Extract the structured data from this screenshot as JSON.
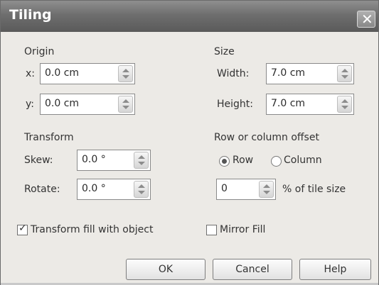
{
  "dialog": {
    "title": "Tiling",
    "close_icon": "close-icon"
  },
  "origin": {
    "heading": "Origin",
    "x_label": "x:",
    "x_value": "0.0 cm",
    "y_label": "y:",
    "y_value": "0.0 cm"
  },
  "size": {
    "heading": "Size",
    "width_label": "Width:",
    "width_value": "7.0 cm",
    "height_label": "Height:",
    "height_value": "7.0 cm"
  },
  "transform": {
    "heading": "Transform",
    "skew_label": "Skew:",
    "skew_value": "0.0 °",
    "rotate_label": "Rotate:",
    "rotate_value": "0.0 °"
  },
  "offset": {
    "heading": "Row or column offset",
    "row_label": "Row",
    "row_selected": true,
    "column_label": "Column",
    "column_selected": false,
    "percent_value": "0",
    "percent_label": "% of tile size"
  },
  "options": {
    "transform_fill_label": "Transform fill with object",
    "transform_fill_checked": true,
    "mirror_fill_label": "Mirror Fill",
    "mirror_fill_checked": false
  },
  "buttons": {
    "ok": "OK",
    "cancel": "Cancel",
    "help": "Help"
  }
}
